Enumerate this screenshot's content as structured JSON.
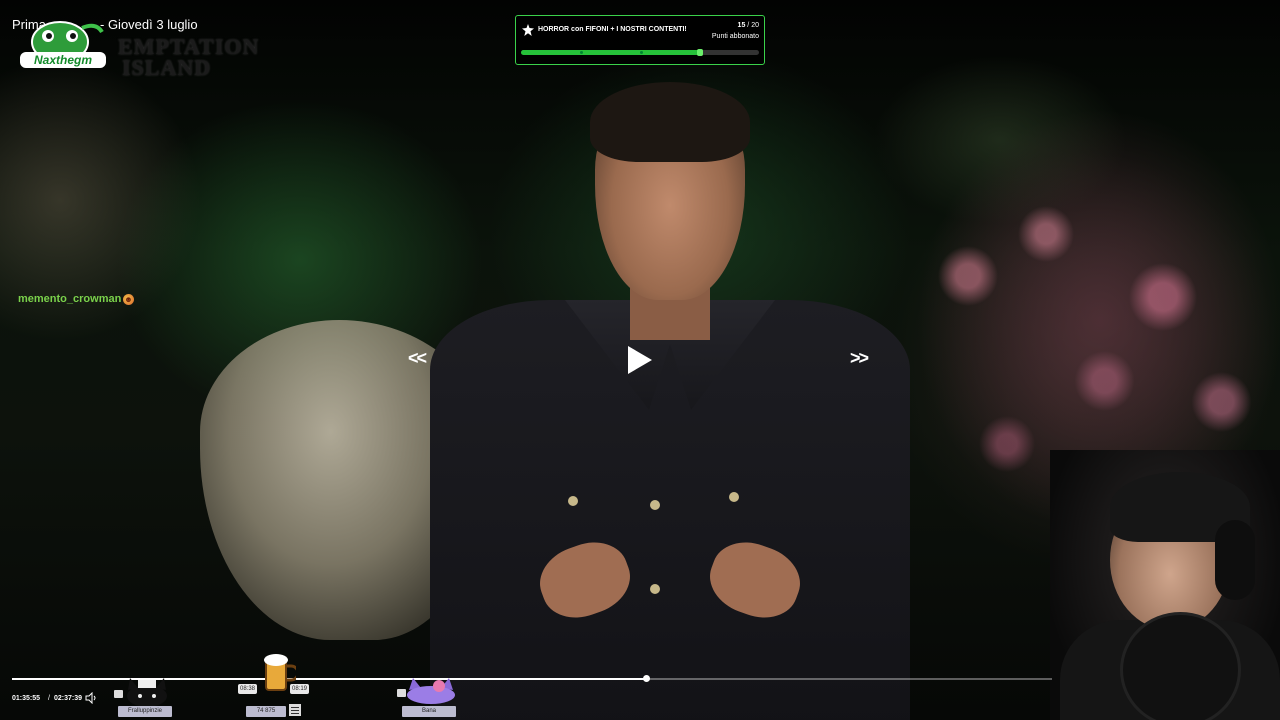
{
  "stream": {
    "title_part1": "Prima",
    "title_part2": "- Giovedì 3 luglio",
    "channel_logo_text": "Naxthegm",
    "show_logo_line1": "EMPTATION",
    "show_logo_line2": "ISLAND"
  },
  "goal": {
    "title": "HORROR con FIFONI + I NOSTRI CONTENTI!",
    "current": "15",
    "separator": "/",
    "target": "20",
    "progress_fraction": 0.75,
    "subtitle": "Punti abbonato",
    "accent": "#26c23a"
  },
  "chat": {
    "username": "memento_crowman",
    "emote": "smiley-emote-icon"
  },
  "controls": {
    "prev_symbol": "<<",
    "next_symbol": ">>",
    "play_icon": "play-icon"
  },
  "playback": {
    "current_time": "01:35:55",
    "separator": "/",
    "duration": "02:37:39",
    "progress_fraction": 0.61,
    "volume_icon": "speaker-icon"
  },
  "markers": [
    {
      "label": "Fralluppinzie",
      "emote": "cat-emote-icon"
    },
    {
      "label": "74 875",
      "time_left": "08:38",
      "time_right": "08:19",
      "emote": "beer-mug-icon"
    },
    {
      "label": "Bana",
      "emote": "purple-cat-emote-icon"
    }
  ]
}
